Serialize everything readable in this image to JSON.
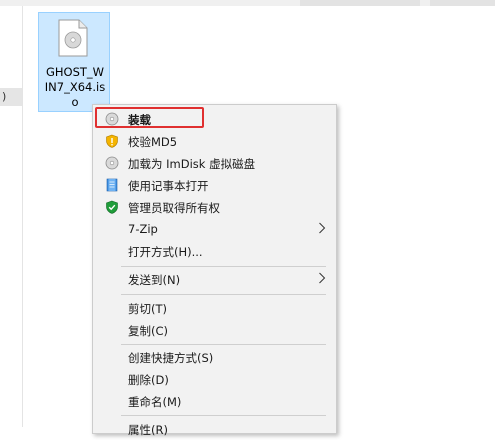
{
  "file": {
    "name": "GHOST_WIN7_X64.iso",
    "label_lines": [
      "GHOST_W",
      "IN7_X64.is",
      "o"
    ]
  },
  "left_fragment": ")",
  "menu": {
    "items": [
      {
        "label": "装载",
        "icon": "disc-icon"
      },
      {
        "label": "校验MD5",
        "icon": "warning-shield-icon"
      },
      {
        "label": "加载为 ImDisk 虚拟磁盘",
        "icon": "disc-icon"
      },
      {
        "label": "使用记事本打开",
        "icon": "notepad-icon"
      },
      {
        "label": "管理员取得所有权",
        "icon": "green-check-shield-icon"
      },
      {
        "label": "7-Zip",
        "submenu": true
      },
      {
        "label": "打开方式(H)..."
      },
      {
        "label": "发送到(N)",
        "submenu": true
      },
      {
        "label": "剪切(T)"
      },
      {
        "label": "复制(C)"
      },
      {
        "label": "创建快捷方式(S)"
      },
      {
        "label": "删除(D)"
      },
      {
        "label": "重命名(M)"
      },
      {
        "label": "属性(R)"
      }
    ]
  },
  "colors": {
    "selection": "#cce8ff",
    "highlight_box": "#e03030",
    "menu_bg": "#f2f2f2"
  }
}
